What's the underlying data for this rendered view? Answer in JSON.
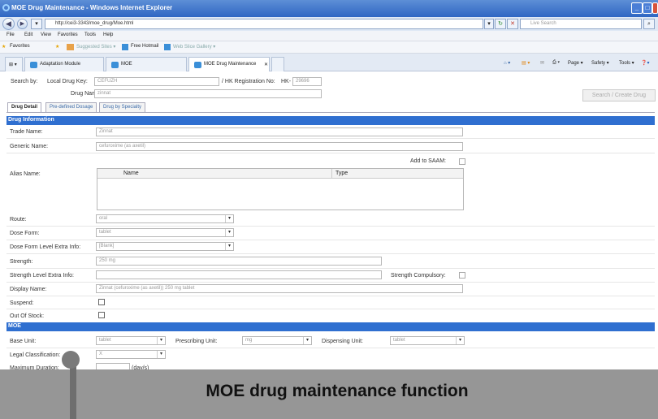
{
  "window": {
    "title": "MOE Drug Maintenance - Windows Internet Explorer",
    "url": "http://cei3-3343/moe_drug/Moe.html",
    "search_placeholder": "Live Search"
  },
  "menu": [
    "File",
    "Edit",
    "View",
    "Favorites",
    "Tools",
    "Help"
  ],
  "favorites": {
    "label": "Favorites",
    "items": [
      "Suggested Sites ▾",
      "Free Hotmail",
      "Web Slice Gallery ▾"
    ]
  },
  "tabs": [
    "Adaptation Module",
    "MOE",
    "MOE Drug Maintenance"
  ],
  "command_bar": [
    "Page ▾",
    "Safety ▾",
    "Tools ▾"
  ],
  "search": {
    "label": "Search by:",
    "local_key_label": "Local Drug Key:",
    "local_key_value": "CEFUZH",
    "hk_reg_label": "/ HK Registration No:",
    "hk_prefix": "HK-",
    "hk_value": "29696",
    "drug_name_label": "Drug Name:",
    "drug_name_value": "zinnat",
    "button": "Search / Create Drug"
  },
  "app_tabs": [
    "Drug Detail",
    "Pre-defined Dosage",
    "Drug by Specialty"
  ],
  "drug_info": {
    "header": "Drug Information",
    "trade_name_label": "Trade Name:",
    "trade_name": "Zinnat",
    "generic_name_label": "Generic Name:",
    "generic_name": "cefuroxime (as axetil)",
    "add_to_saam_label": "Add to SAAM:",
    "alias_label": "Alias Name:",
    "alias_col_name": "Name",
    "alias_col_type": "Type",
    "route_label": "Route:",
    "route": "oral",
    "dose_form_label": "Dose Form:",
    "dose_form": "tablet",
    "dose_form_extra_label": "Dose Form Level Extra Info:",
    "dose_form_extra": "[Blank]",
    "strength_label": "Strength:",
    "strength": "250 mg",
    "strength_extra_label": "Strength Level Extra Info:",
    "strength_compulsory_label": "Strength Compulsory:",
    "display_name_label": "Display Name:",
    "display_name": "Zinnat (cefuroxime (as axetil)) 250 mg tablet",
    "suspend_label": "Suspend:",
    "out_of_stock_label": "Out Of Stock:"
  },
  "moe": {
    "header": "MOE",
    "base_unit_label": "Base Unit:",
    "base_unit": "tablet",
    "prescribing_unit_label": "Prescribing Unit:",
    "prescribing_unit": "mg",
    "dispensing_unit_label": "Dispensing Unit:",
    "dispensing_unit": "tablet",
    "legal_class_label": "Legal Classification:",
    "legal_class": "X",
    "max_duration_label": "Maximum Duration:",
    "max_duration_unit": "(day/s)"
  },
  "caption": "MOE drug maintenance function"
}
